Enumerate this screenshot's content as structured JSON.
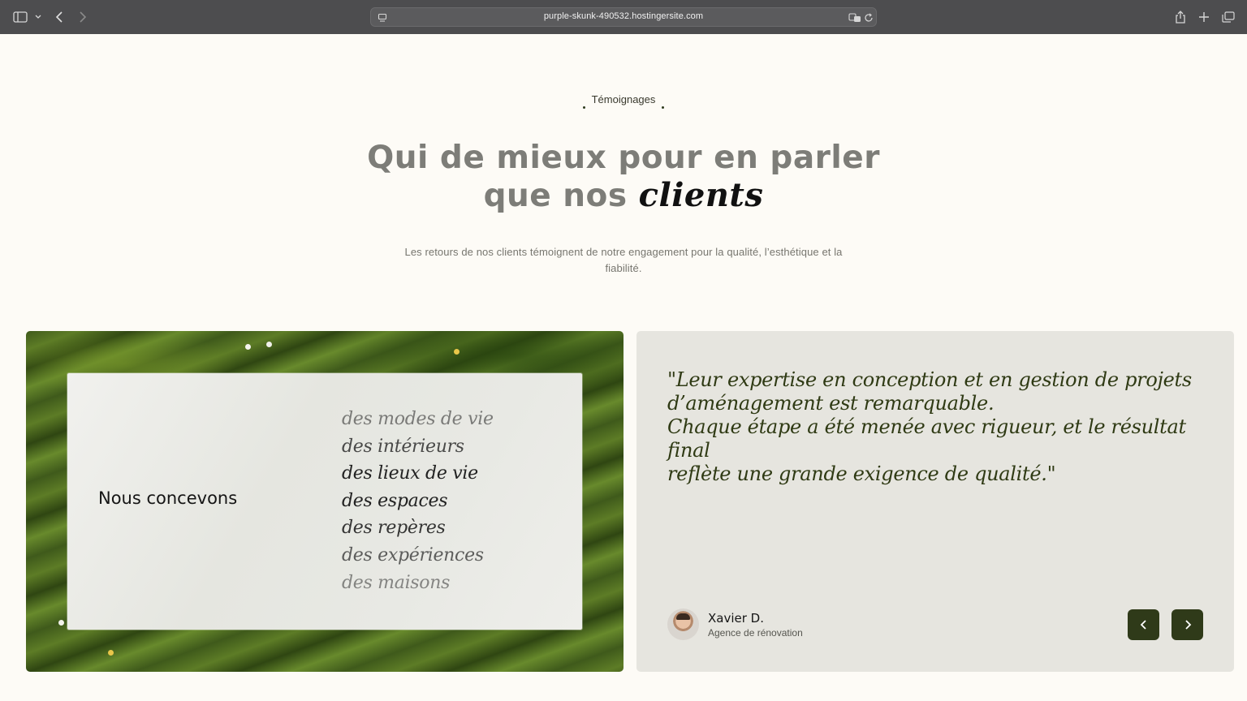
{
  "browser": {
    "url": "purple-skunk-490532.hostingersite.com",
    "icons": [
      "sidebar-icon",
      "chevron-down-icon",
      "back-icon",
      "forward-icon",
      "page-icon",
      "translate-icon",
      "reload-icon",
      "share-icon",
      "new-tab-icon",
      "tabs-icon"
    ]
  },
  "section": {
    "eyebrow": "Témoignages",
    "title_line1": "Qui de mieux pour en parler",
    "title_line2_plain": "que nos ",
    "title_line2_emphasis": "clients",
    "subtitle": "Les retours de nos clients témoignent de notre engagement pour la qualité, l’esthétique et la fiabilité."
  },
  "image_card": {
    "lead": "Nous concevons",
    "words": [
      {
        "text": "des modes de vie",
        "opacity": 0.55
      },
      {
        "text": "des intérieurs",
        "opacity": 0.8
      },
      {
        "text": "des lieux de vie",
        "opacity": 1
      },
      {
        "text": "des espaces",
        "opacity": 1
      },
      {
        "text": "des repères",
        "opacity": 0.9
      },
      {
        "text": "des expériences",
        "opacity": 0.7
      },
      {
        "text": "des maisons",
        "opacity": 0.5
      }
    ]
  },
  "testimonial": {
    "quote_lines": [
      "\"Leur expertise en conception et en gestion de projets",
      "d’aménagement est remarquable.",
      "Chaque étape a été menée avec rigueur, et le résultat final",
      "reflète une grande exigence de qualité.\""
    ],
    "author_name": "Xavier D.",
    "author_role": "Agence de rénovation",
    "prev_icon": "chevron-left-icon",
    "next_icon": "chevron-right-icon"
  },
  "colors": {
    "background": "#fdfbf6",
    "accent_dark_green": "#2f3a19",
    "card_bg": "#e6e5df"
  }
}
